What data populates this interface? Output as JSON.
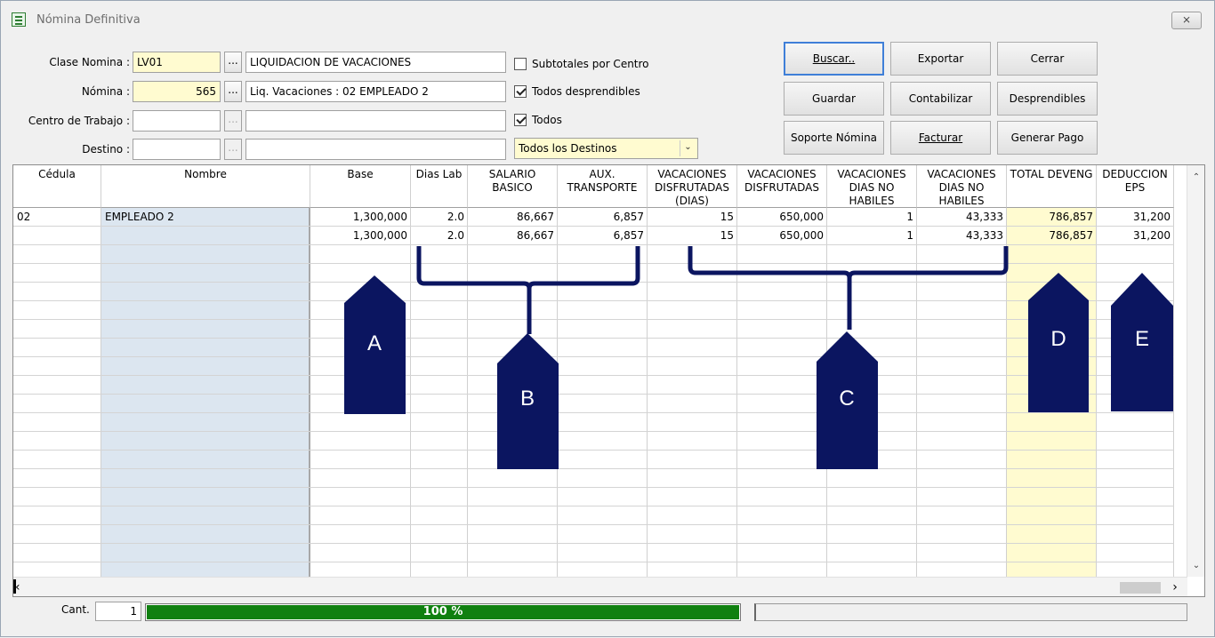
{
  "window": {
    "title": "Nómina Definitiva",
    "close_label": "⨯"
  },
  "form": {
    "clase_nomina": {
      "label": "Clase Nomina :",
      "code": "LV01",
      "description": "LIQUIDACION DE VACACIONES"
    },
    "nomina": {
      "label": "Nómina :",
      "number": "565",
      "description": "Liq. Vacaciones : 02 EMPLEADO 2"
    },
    "centro_trabajo": {
      "label": "Centro de Trabajo :",
      "code": "",
      "description": ""
    },
    "destino": {
      "label": "Destino :",
      "code": "",
      "description": ""
    },
    "ellipsis": "...",
    "checkboxes": [
      {
        "label": "Subtotales por Centro",
        "checked": false
      },
      {
        "label": "Todos desprendibles",
        "checked": true
      },
      {
        "label": "Todos",
        "checked": true
      }
    ],
    "destinos_select": {
      "value": "Todos los Destinos"
    }
  },
  "buttons": {
    "buscar": "Buscar..",
    "exportar": "Exportar",
    "cerrar": "Cerrar",
    "guardar": "Guardar",
    "contabilizar": "Contabilizar",
    "desprendibles": "Desprendibles",
    "soporte": "Soporte Nómina",
    "facturar": "Facturar",
    "generar_pago": "Generar Pago"
  },
  "grid": {
    "columns": [
      "Cédula",
      "Nombre",
      "Base",
      "Dias Lab",
      "SALARIO BASICO",
      "AUX. TRANSPORTE",
      "VACACIONES DISFRUTADAS (DIAS)",
      "VACACIONES DISFRUTADAS",
      "VACACIONES DIAS NO HABILES",
      "VACACIONES DIAS NO HABILES",
      "TOTAL DEVENG",
      "DEDUCCION EPS"
    ],
    "rows": [
      [
        "02",
        "EMPLEADO 2",
        "1,300,000",
        "2.0",
        "86,667",
        "6,857",
        "15",
        "650,000",
        "1",
        "43,333",
        "786,857",
        "31,200"
      ],
      [
        "",
        "",
        "1,300,000",
        "2.0",
        "86,667",
        "6,857",
        "15",
        "650,000",
        "1",
        "43,333",
        "786,857",
        "31,200"
      ]
    ]
  },
  "status": {
    "cant_label": "Cant.",
    "cant_value": "1",
    "progress_text": "100 %",
    "progress": 1.0
  },
  "callouts": [
    "A",
    "B",
    "C",
    "D",
    "E"
  ],
  "colors": {
    "callout": "#0b1560",
    "progress": "#108010",
    "nombre_col": "#dce6f0",
    "total_col": "#fffbd0"
  }
}
